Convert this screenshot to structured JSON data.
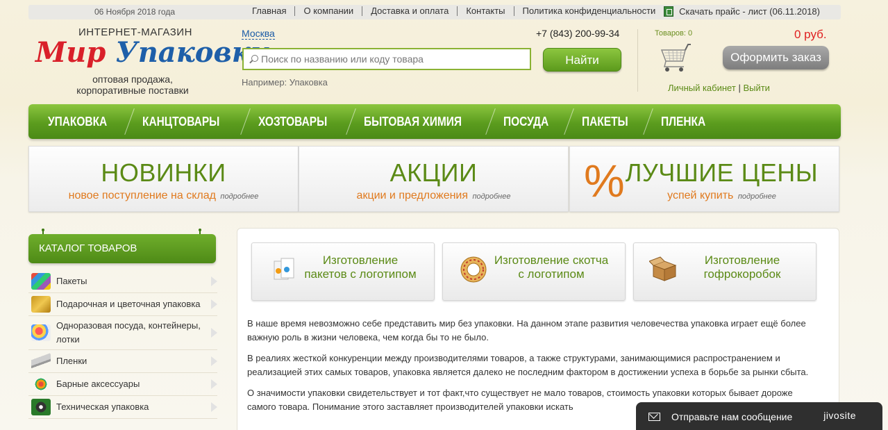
{
  "topbar": {
    "date": "06 Ноября 2018 года",
    "links": [
      "Главная",
      "О компании",
      "Доставка и оплата",
      "Контакты",
      "Политика конфиденциальности"
    ],
    "price_link": "Скачать прайс - лист (06.11.2018)"
  },
  "logo": {
    "top": "ИНТЕРНЕТ-МАГАЗИН",
    "word1": "Мир",
    "word2": "Упаковки",
    "sub1": "оптовая продажа,",
    "sub2": "корпоративные поставки"
  },
  "header": {
    "city": "Москва",
    "phone": "+7 (843) 200-99-34",
    "search_placeholder": "Поиск по названию или коду товара",
    "find_label": "Найти",
    "example": "Например: Упаковка"
  },
  "cart": {
    "count": "Товаров: 0",
    "sum": "0 руб.",
    "order_label": "Оформить заказ",
    "account": "Личный кабинет",
    "sep": "|",
    "logout": "Выйти"
  },
  "nav": [
    "УПАКОВКА",
    "КАНЦТОВАРЫ",
    "ХОЗТОВАРЫ",
    "БЫТОВАЯ ХИМИЯ",
    "ПОСУДА",
    "ПАКЕТЫ",
    "ПЛЕНКА"
  ],
  "promos": [
    {
      "title": "НОВИНКИ",
      "sub": "новое поступление на склад",
      "more": "подробнее"
    },
    {
      "title": "АКЦИИ",
      "sub": "акции и предложения",
      "more": "подробнее"
    },
    {
      "title": "ЛУЧШИЕ ЦЕНЫ",
      "sub": "успей купить",
      "more": "подробнее",
      "symbol": "%"
    }
  ],
  "catalog": {
    "title": "КАТАЛОГ ТОВАРОВ",
    "items": [
      "Пакеты",
      "Подарочная и цветочная упаковка",
      "Одноразовая посуда, контейнеры, лотки",
      "Пленки",
      "Барные аксессуары",
      "Техническая упаковка"
    ]
  },
  "services": [
    {
      "l1": "Изготовление",
      "l2": "пакетов с логотипом"
    },
    {
      "l1": "Изготовление скотча",
      "l2": "с логотипом"
    },
    {
      "l1": "Изготовление",
      "l2": "гофрокоробок"
    }
  ],
  "article": {
    "p1": "В наше время невозможно себе представить мир без упаковки. На данном этапе развития человечества упаковка играет ещё более важную роль в жизни человека, чем когда бы то не было.",
    "p2": "В реалиях жесткой конкуренции между производителями товаров, а также структурами, занимающимися распространением и реализацией этих самых товаров, упаковка является далеко не последним фактором в достижении успеха в борьбе за рынки сбыта.",
    "p3": "О значимости упаковки свидетельствует и тот факт,что существует не мало товаров, стоимость упаковки которых бывает дороже самого товара. Понимание этого заставляет производителей упаковки искать"
  },
  "chat": {
    "label": "Отправьте нам сообщение",
    "brand": "jivosite"
  }
}
